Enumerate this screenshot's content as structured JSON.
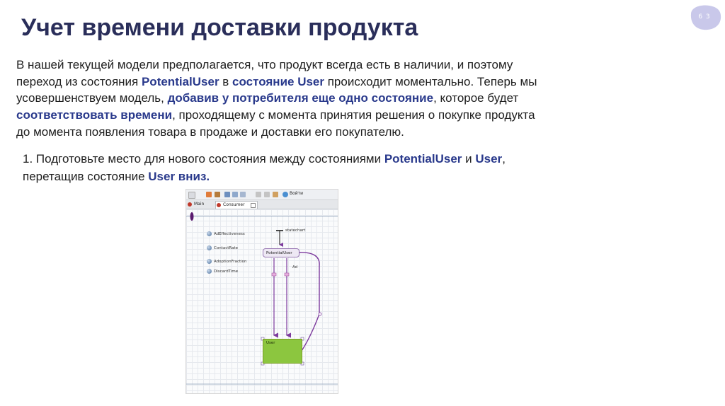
{
  "page": {
    "number": "6 3"
  },
  "title": "Учет времени доставки продукта",
  "paragraph": {
    "p1": "В нашей текущей модели предполагается, что продукт всегда есть в наличии, и поэтому переход из состояния ",
    "h1": "PotentialUser",
    "p2": " в ",
    "h2": "состояние User",
    "p3": " происходит моментально. Теперь мы усовершенствуем модель, ",
    "h3": "добавив у потребителя еще одно состояние",
    "p4": ", которое будет ",
    "h4": "соответствовать времени",
    "p5": ", проходящему с момента принятия решения о покупке продукта до момента появления товара в продаже и доставки его покупателю."
  },
  "step1": {
    "p1": "1. Подготовьте место для нового состояния между состояниями ",
    "h1": "PotentialUser",
    "p2": " и ",
    "h2": "User",
    "p3": ", перетащив состояние ",
    "h3": "User вниз."
  },
  "screenshot": {
    "toolbar": {
      "login_label": "Войти"
    },
    "tabs": {
      "main": "Main",
      "consumer": "Consumer"
    },
    "params": [
      "AdEffectiveness",
      "ContactRate",
      "AdoptionFraction",
      "DiscardTime"
    ],
    "statechart_label": "statechart",
    "state_potential_user": "PotentialUser",
    "ad_label": "Ad",
    "state_user": "User"
  },
  "colors": {
    "title": "#2a2e5a",
    "highlight": "#2a3a8c",
    "badge": "#c9c8ea",
    "user_state": "#8cc63f",
    "transition": "#7d3b9e"
  }
}
